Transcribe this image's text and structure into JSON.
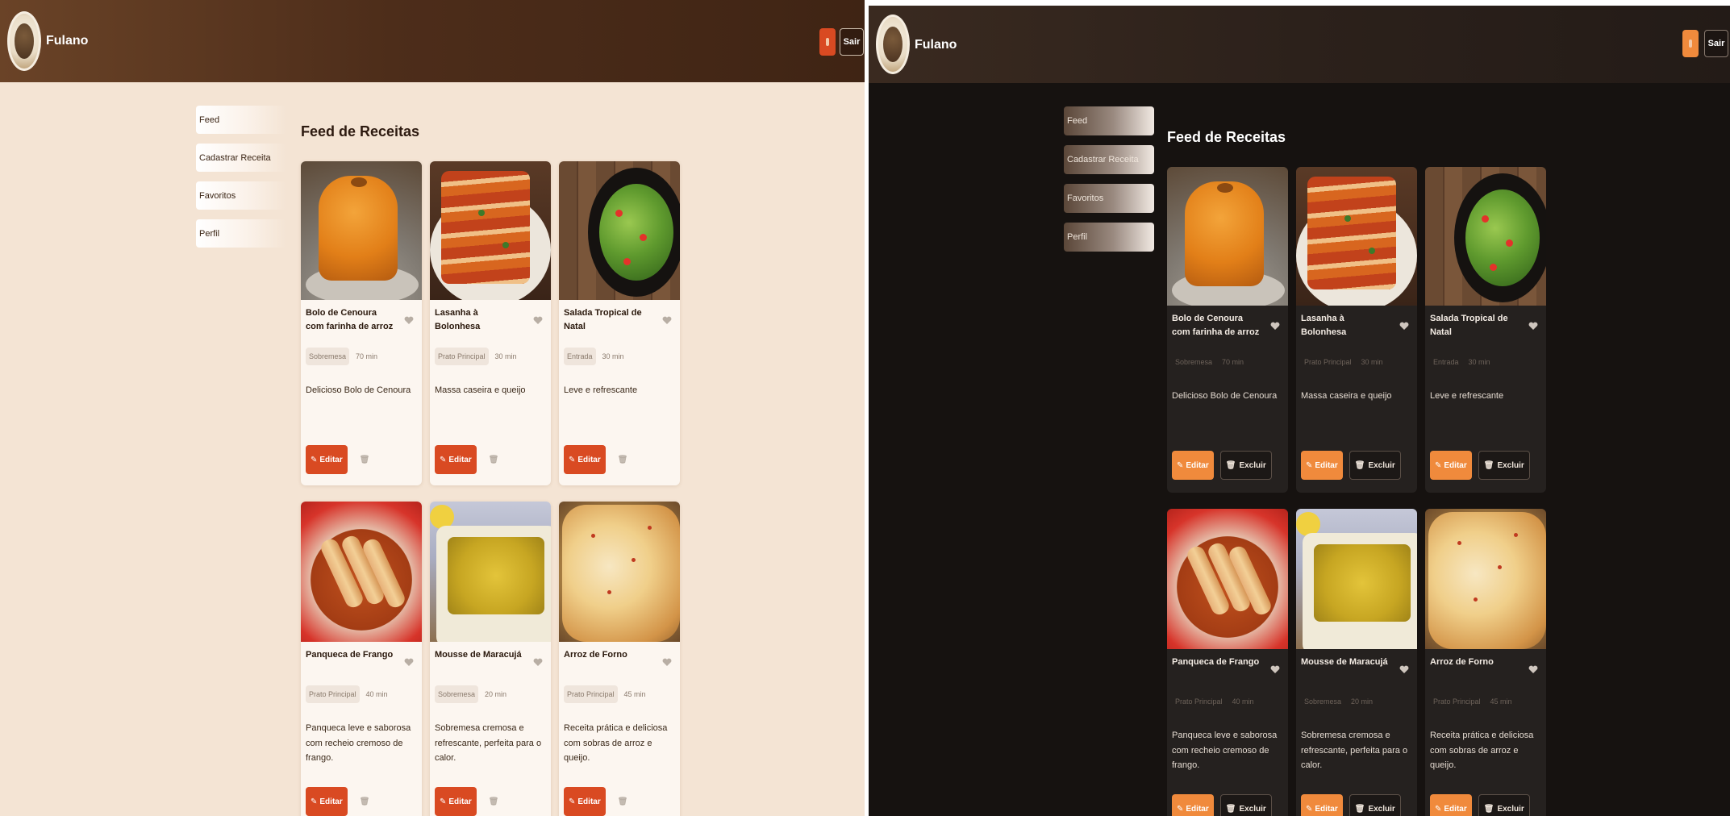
{
  "app": {
    "brand": "Fulano",
    "logout_label": "Sair"
  },
  "sidebar": {
    "items": [
      {
        "label": "Feed"
      },
      {
        "label": "Cadastrar Receita"
      },
      {
        "label": "Favoritos"
      },
      {
        "label": "Perfil"
      }
    ]
  },
  "main": {
    "title": "Feed de Receitas"
  },
  "actions": {
    "edit_label": "Editar",
    "delete_label": "Excluir"
  },
  "recipes": [
    {
      "title": "Bolo de Cenoura com farinha de arroz",
      "category": "Sobremesa",
      "time": "70 min",
      "description": "Delicioso Bolo de Cenoura",
      "image": "carrot-cake"
    },
    {
      "title": "Lasanha à Bolonhesa",
      "category": "Prato Principal",
      "time": "30 min",
      "description": "Massa caseira e queijo",
      "image": "lasagna"
    },
    {
      "title": "Salada Tropical de Natal",
      "category": "Entrada",
      "time": "30 min",
      "description": "Leve e refrescante",
      "image": "salad"
    },
    {
      "title": "Panqueca de Frango",
      "category": "Prato Principal",
      "time": "40 min",
      "description": "Panqueca leve e saborosa com recheio cremoso de frango.",
      "image": "chicken-pancake"
    },
    {
      "title": "Mousse de Maracujá",
      "category": "Sobremesa",
      "time": "20 min",
      "description": "Sobremesa cremosa e refrescante, perfeita para o calor.",
      "image": "passionfruit-mousse"
    },
    {
      "title": "Arroz de Forno",
      "category": "Prato Principal",
      "time": "45 min",
      "description": "Receita prática e deliciosa com sobras de arroz e queijo.",
      "image": "baked-rice"
    }
  ],
  "icons": {
    "favorite": "heart-icon",
    "edit": "pencil-icon",
    "delete": "trash-icon",
    "theme": "theme-toggle-icon"
  },
  "colors": {
    "light_accent": "#d94a22",
    "dark_accent": "#f08a3c",
    "light_background": "#f4e4d4",
    "dark_background": "#161210",
    "header_brown": "#4d2d1a"
  }
}
